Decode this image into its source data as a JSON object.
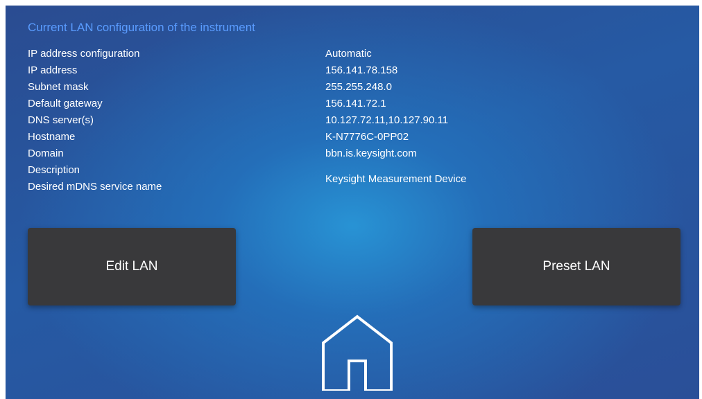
{
  "heading": "Current LAN configuration of the instrument",
  "settings": [
    {
      "label": "IP address configuration",
      "value": "Automatic"
    },
    {
      "label": "IP address",
      "value": "156.141.78.158"
    },
    {
      "label": "Subnet mask",
      "value": "255.255.248.0"
    },
    {
      "label": "Default gateway",
      "value": "156.141.72.1"
    },
    {
      "label": "DNS server(s)",
      "value": "10.127.72.11,10.127.90.11"
    },
    {
      "label": "Hostname",
      "value": "K-N7776C-0PP02"
    },
    {
      "label": "Domain",
      "value": "bbn.is.keysight.com"
    },
    {
      "label": "Description",
      "value": "Keysight Measurement Device"
    },
    {
      "label": "Desired mDNS service name",
      "value": ""
    }
  ],
  "buttons": {
    "edit_lan": "Edit LAN",
    "preset_lan": "Preset LAN"
  },
  "icons": {
    "home": "home-icon"
  },
  "colors": {
    "heading": "#5a9cff",
    "button_bg": "#39393b",
    "text": "#ffffff"
  }
}
